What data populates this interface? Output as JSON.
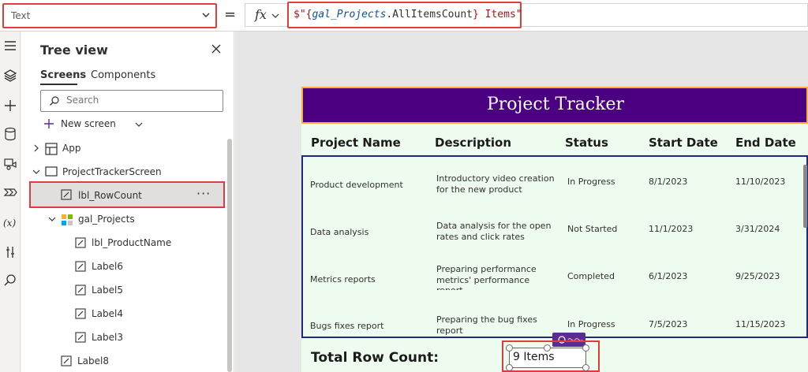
{
  "formula_bar": {
    "property": "Text",
    "equals": "=",
    "fx": "fx",
    "formula": {
      "prefix": "$\"{",
      "identifier": "gal_Projects",
      "dot": ".",
      "property": "AllItemsCount",
      "suffix": "} Items\""
    }
  },
  "tree": {
    "title": "Tree view",
    "tabs": [
      "Screens",
      "Components"
    ],
    "search_placeholder": "Search",
    "new_screen": "New screen",
    "nodes": {
      "app": "App",
      "screen": "ProjectTrackerScreen",
      "row_count": "lbl_RowCount",
      "gallery": "gal_Projects",
      "product_name": "lbl_ProductName",
      "label6": "Label6",
      "label5": "Label5",
      "label4": "Label4",
      "label3": "Label3",
      "label8": "Label8"
    },
    "more": "···"
  },
  "app_screen": {
    "title": "Project Tracker",
    "columns": [
      "Project Name",
      "Description",
      "Status",
      "Start Date",
      "End Date"
    ],
    "rows": [
      {
        "name": "Product development",
        "desc1": "Introductory video creation",
        "desc2": "for the new product",
        "desc3": "",
        "status": "In Progress",
        "start": "8/1/2023",
        "end": "11/10/2023"
      },
      {
        "name": "Data analysis",
        "desc1": "Data analysis for the open",
        "desc2": "rates and click rates",
        "desc3": "",
        "status": "Not Started",
        "start": "11/1/2023",
        "end": "3/31/2024"
      },
      {
        "name": "Metrics reports",
        "desc1": "Preparing performance",
        "desc2": "metrics' performance",
        "desc3": "report",
        "status": "Completed",
        "start": "6/1/2023",
        "end": "9/25/2023"
      },
      {
        "name": "Bugs fixes report",
        "desc1": "Preparing the bug fixes",
        "desc2": "report",
        "desc3": "",
        "status": "In Progress",
        "start": "7/5/2023",
        "end": "11/15/2023"
      }
    ],
    "total_label": "Total Row Count:",
    "count_value": "9 Items"
  },
  "colors": {
    "header_bg": "#4b0082",
    "header_border": "#f2b233",
    "highlight": "#e03c3c",
    "screen_bg": "#eefcef",
    "gallery_border": "#1f2a7a"
  }
}
